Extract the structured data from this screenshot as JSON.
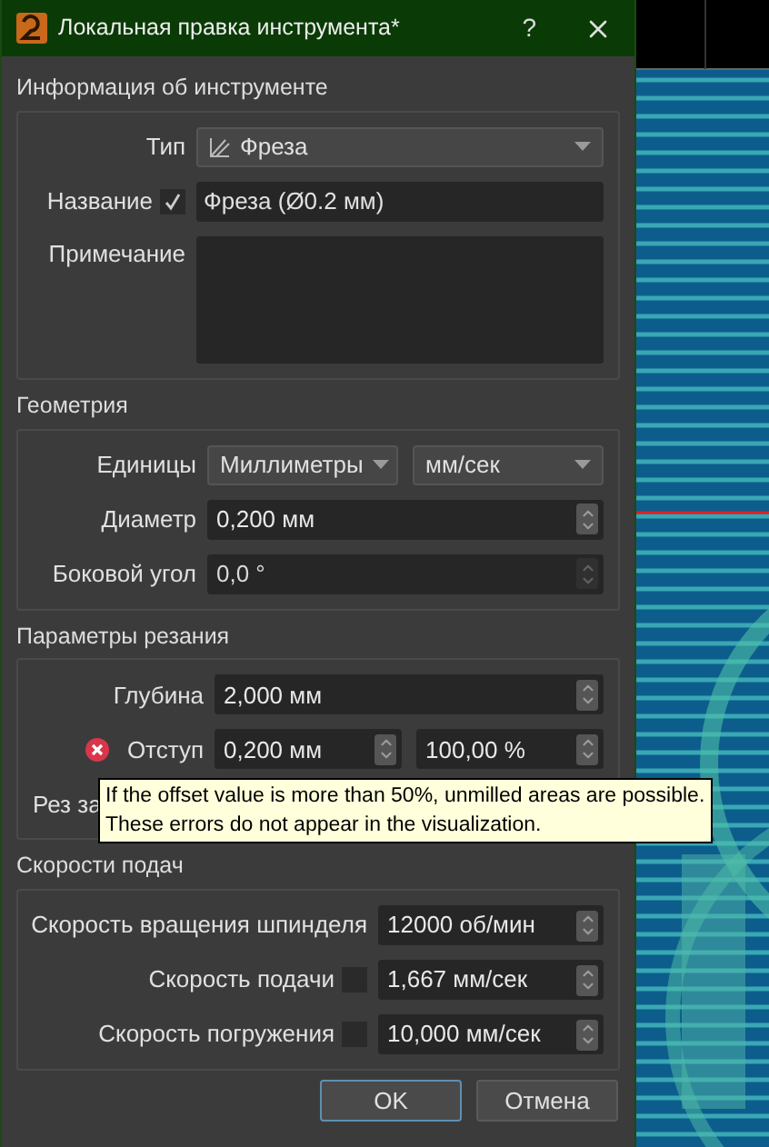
{
  "window": {
    "title": "Локальная правка инструмента*",
    "help": "?"
  },
  "sections": [
    {
      "title": "Информация об инструменте",
      "rows": [
        {
          "label": "Тип",
          "fields": [
            {
              "kind": "tool-select",
              "value": "Фреза"
            }
          ]
        },
        {
          "label": "Название",
          "checked": true,
          "fields": [
            {
              "kind": "text",
              "value": "Фреза (Ø0.2 мм)"
            }
          ]
        },
        {
          "label": "Примечание",
          "fields": [
            {
              "kind": "textarea"
            }
          ]
        }
      ]
    },
    {
      "title": "Геометрия",
      "rows": [
        {
          "label": "Единицы",
          "fields": [
            {
              "kind": "select",
              "value": "Миллиметры"
            },
            {
              "kind": "select",
              "value": "мм/сек"
            }
          ]
        },
        {
          "label": "Диаметр",
          "fields": [
            {
              "kind": "spin",
              "value": "0,200 мм"
            }
          ]
        },
        {
          "label": "Боковой угол",
          "fields": [
            {
              "kind": "spin",
              "value": "0,0 °",
              "disabled": true
            }
          ]
        }
      ]
    },
    {
      "title": "Параметры резания",
      "rows": [
        {
          "label": "Глубина",
          "fields": [
            {
              "kind": "spin",
              "value": "2,000 мм"
            }
          ]
        },
        {
          "label": "Отступ",
          "error": true,
          "fields": [
            {
              "kind": "spin",
              "value": "0,200 мм"
            },
            {
              "kind": "spin",
              "value": "100,00 %"
            }
          ]
        },
        {
          "label": "Рез за"
        }
      ]
    },
    {
      "title": "Скорости подач",
      "rows": [
        {
          "label": "Скорость вращения шпинделя",
          "fields": [
            {
              "kind": "spin",
              "value": "12000 об/мин"
            }
          ]
        },
        {
          "label": "Скорость подачи",
          "checked": false,
          "fields": [
            {
              "kind": "spin",
              "value": "1,667 мм/сек"
            }
          ]
        },
        {
          "label": "Скорость погружения",
          "checked": false,
          "fields": [
            {
              "kind": "spin",
              "value": "10,000 мм/сек"
            }
          ]
        }
      ]
    }
  ],
  "tooltip": {
    "lines": [
      "If the offset value is more than 50%, unmilled areas are possible.",
      "These errors do not appear in the visualization."
    ]
  },
  "buttons": [
    {
      "label": "OK",
      "default": true
    },
    {
      "label": "Отмена",
      "default": false
    }
  ]
}
